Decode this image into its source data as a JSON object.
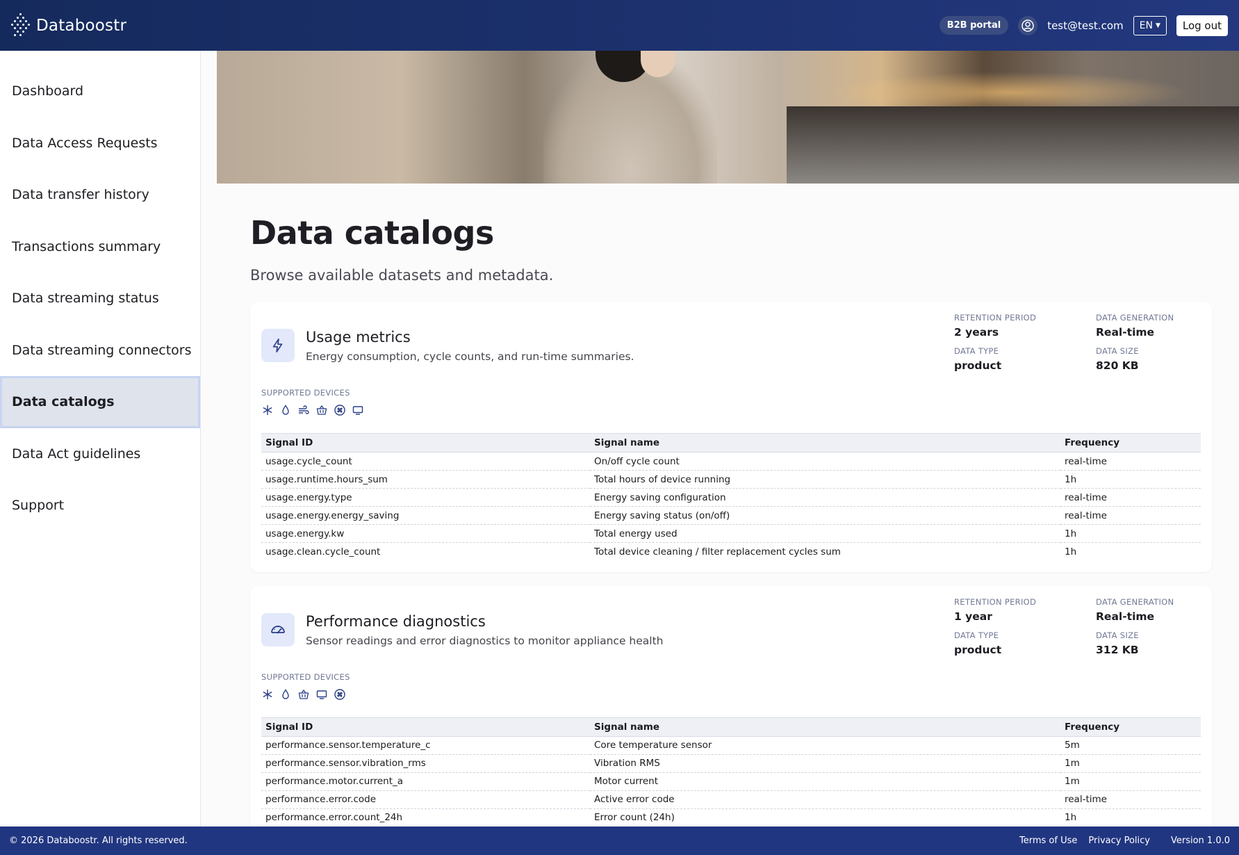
{
  "app": {
    "brand": "Databoostr"
  },
  "header": {
    "portal_badge": "B2B portal",
    "user_email": "test@test.com",
    "language": "EN",
    "logout_label": "Log out"
  },
  "sidebar": {
    "items": [
      {
        "label": "Dashboard"
      },
      {
        "label": "Data Access Requests"
      },
      {
        "label": "Data transfer history"
      },
      {
        "label": "Transactions summary"
      },
      {
        "label": "Data streaming status"
      },
      {
        "label": "Data streaming connectors"
      },
      {
        "label": "Data catalogs",
        "active": true
      },
      {
        "label": "Data Act guidelines"
      },
      {
        "label": "Support"
      }
    ]
  },
  "page": {
    "title": "Data catalogs",
    "subtitle": "Browse available datasets and metadata."
  },
  "labels": {
    "retention_period": "RETENTION PERIOD",
    "data_generation": "DATA GENERATION",
    "data_type": "DATA TYPE",
    "data_size": "DATA SIZE",
    "supported_devices": "SUPPORTED DEVICES",
    "col_signal_id": "Signal ID",
    "col_signal_name": "Signal name",
    "col_frequency": "Frequency"
  },
  "catalogs": [
    {
      "icon": "lightning-icon",
      "title": "Usage metrics",
      "description": "Energy consumption, cycle counts, and run-time summaries.",
      "retention_period": "2 years",
      "data_generation": "Real-time",
      "data_type": "product",
      "data_size": "820 KB",
      "devices": [
        "snowflake-icon",
        "water-drop-icon",
        "wind-icon",
        "basket-icon",
        "fan-icon",
        "monitor-icon"
      ],
      "signals": [
        {
          "id": "usage.cycle_count",
          "name": "On/off cycle count",
          "frequency": "real-time"
        },
        {
          "id": "usage.runtime.hours_sum",
          "name": "Total hours of device running",
          "frequency": "1h"
        },
        {
          "id": "usage.energy.type",
          "name": "Energy saving configuration",
          "frequency": "real-time"
        },
        {
          "id": "usage.energy.energy_saving",
          "name": "Energy saving status (on/off)",
          "frequency": "real-time"
        },
        {
          "id": "usage.energy.kw",
          "name": "Total energy used",
          "frequency": "1h"
        },
        {
          "id": "usage.clean.cycle_count",
          "name": "Total device cleaning / filter replacement cycles sum",
          "frequency": "1h"
        }
      ]
    },
    {
      "icon": "gauge-icon",
      "title": "Performance diagnostics",
      "description": "Sensor readings and error diagnostics to monitor appliance health",
      "retention_period": "1 year",
      "data_generation": "Real-time",
      "data_type": "product",
      "data_size": "312 KB",
      "devices": [
        "snowflake-icon",
        "water-drop-icon",
        "basket-icon",
        "monitor-icon",
        "fan-icon"
      ],
      "signals": [
        {
          "id": "performance.sensor.temperature_c",
          "name": "Core temperature sensor",
          "frequency": "5m"
        },
        {
          "id": "performance.sensor.vibration_rms",
          "name": "Vibration RMS",
          "frequency": "1m"
        },
        {
          "id": "performance.motor.current_a",
          "name": "Motor current",
          "frequency": "1m"
        },
        {
          "id": "performance.error.code",
          "name": "Active error code",
          "frequency": "real-time"
        },
        {
          "id": "performance.error.count_24h",
          "name": "Error count (24h)",
          "frequency": "1h"
        }
      ]
    }
  ],
  "footer": {
    "copyright": "© 2026 Databoostr. All rights reserved.",
    "terms": "Terms of Use",
    "privacy": "Privacy Policy",
    "version": "Version 1.0.0"
  }
}
